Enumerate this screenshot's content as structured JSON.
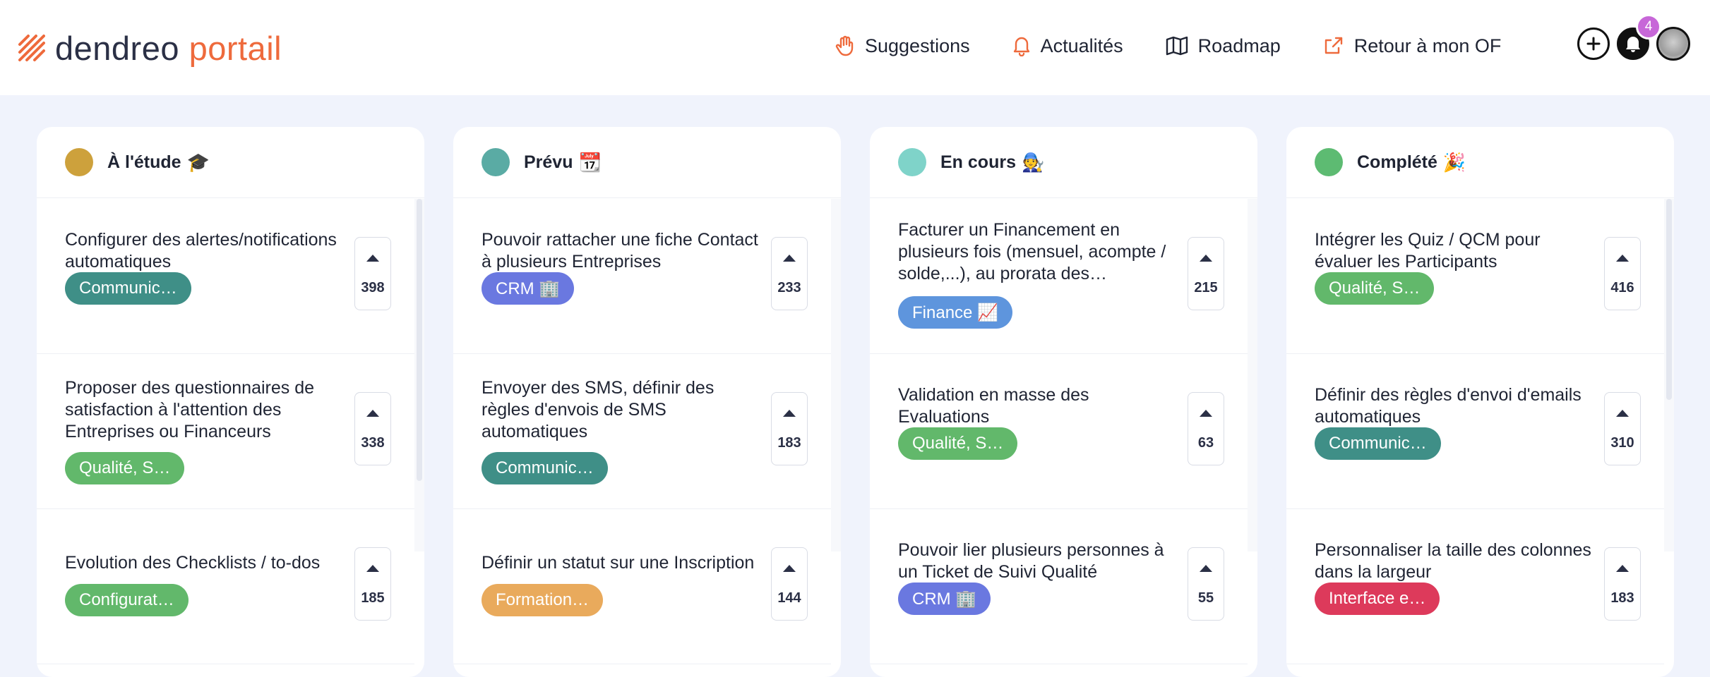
{
  "header": {
    "logo_part1": "dendreo",
    "logo_part2": "portail",
    "nav": [
      {
        "label": "Suggestions",
        "icon": "hand-icon"
      },
      {
        "label": "Actualités",
        "icon": "bell-icon"
      },
      {
        "label": "Roadmap",
        "icon": "map-icon"
      },
      {
        "label": "Retour à mon OF",
        "icon": "share-icon"
      }
    ],
    "notification_count": "4"
  },
  "columns": [
    {
      "title": "À l'étude",
      "emoji": "🎓",
      "dot_color": "#cda13c",
      "cards": [
        {
          "text": "Configurer des alertes/notifications automatiques",
          "tag": "Communic…",
          "tag_color": "#3f8f87",
          "votes": "398"
        },
        {
          "text": "Proposer des questionnaires de satisfaction à l'attention des Entreprises ou Financeurs",
          "tag": "Qualité, S…",
          "tag_color": "#62b86b",
          "votes": "338"
        },
        {
          "text": "Evolution des Checklists / to-dos",
          "tag": "Configurat…",
          "tag_color": "#62b86b",
          "votes": "185"
        }
      ]
    },
    {
      "title": "Prévu",
      "emoji": "📆",
      "dot_color": "#5aaba4",
      "cards": [
        {
          "text": "Pouvoir rattacher une fiche Contact à plusieurs Entreprises",
          "tag": "CRM 🏢",
          "tag_color": "#6a78e0",
          "votes": "233"
        },
        {
          "text": "Envoyer des SMS, définir des règles d'envois de SMS automatiques",
          "tag": "Communic…",
          "tag_color": "#3f8f87",
          "votes": "183"
        },
        {
          "text": "Définir un statut sur une Inscription",
          "tag": "Formation…",
          "tag_color": "#e9aa5c",
          "votes": "144"
        }
      ]
    },
    {
      "title": "En cours",
      "emoji": "🧑‍🔧",
      "dot_color": "#7fd3c9",
      "cards": [
        {
          "text": "Facturer un Financement en plusieurs fois (mensuel, acompte / solde,...), au prorata des…",
          "tag": "Finance 📈",
          "tag_color": "#5e95dd",
          "votes": "215"
        },
        {
          "text": "Validation en masse des Evaluations",
          "tag": "Qualité, S…",
          "tag_color": "#62b86b",
          "votes": "63"
        },
        {
          "text": "Pouvoir lier plusieurs personnes à un Ticket de Suivi Qualité",
          "tag": "CRM 🏢",
          "tag_color": "#6a78e0",
          "votes": "55"
        }
      ]
    },
    {
      "title": "Complété",
      "emoji": "🎉",
      "dot_color": "#5dbb72",
      "cards": [
        {
          "text": "Intégrer les Quiz / QCM pour évaluer les Participants",
          "tag": "Qualité, S…",
          "tag_color": "#62b86b",
          "votes": "416"
        },
        {
          "text": "Définir des règles d'envoi d'emails automatiques",
          "tag": "Communic…",
          "tag_color": "#3f8f87",
          "votes": "310"
        },
        {
          "text": "Personnaliser la taille des colonnes dans la largeur",
          "tag": "Interface e…",
          "tag_color": "#dd3a5b",
          "votes": "183"
        }
      ]
    }
  ]
}
